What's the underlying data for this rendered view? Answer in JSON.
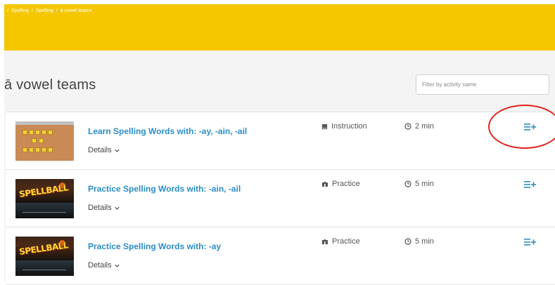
{
  "breadcrumb": [
    "Spelling",
    "Spelling",
    "ā vowel teams"
  ],
  "page": {
    "title": "ā vowel teams"
  },
  "filter": {
    "placeholder": "Filter by activity name"
  },
  "activities": [
    {
      "title": "Learn Spelling Words with: -ay, -ain, -ail",
      "details_label": "Details",
      "type": "Instruction",
      "type_icon": "book-icon",
      "duration": "2 min",
      "thumbnail": "word-board"
    },
    {
      "title": "Practice Spelling Words with: -ain, -ail",
      "details_label": "Details",
      "type": "Practice",
      "type_icon": "puzzle-icon",
      "duration": "5 min",
      "thumbnail": "spellball-game"
    },
    {
      "title": "Practice Spelling Words with: -ay",
      "details_label": "Details",
      "type": "Practice",
      "type_icon": "puzzle-icon",
      "duration": "5 min",
      "thumbnail": "spellball-game"
    }
  ],
  "thumbnail_text": {
    "spellball": "SPELLBALL"
  },
  "icons": {
    "add": "add-to-playlist-icon",
    "clock": "clock-icon",
    "details": "chevron-down-icon"
  },
  "colors": {
    "banner": "#f4c700",
    "link": "#2b8ec8",
    "annotation": "#e0261e"
  }
}
